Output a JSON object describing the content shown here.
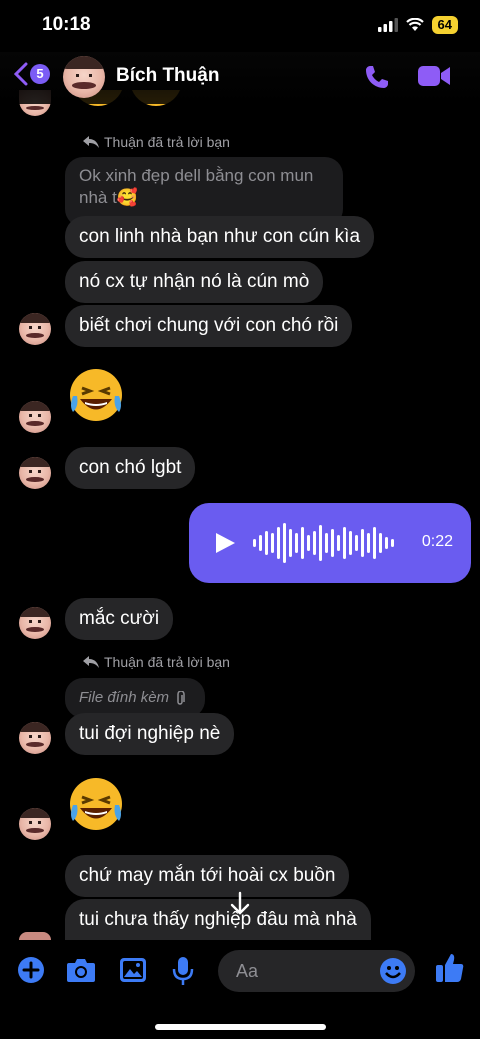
{
  "status_bar": {
    "time": "10:18",
    "battery": "64"
  },
  "header": {
    "back_count": "5",
    "contact_name": "Bích Thuận"
  },
  "messages": {
    "reply1_label": "Thuận đã trả lời bạn",
    "quoted1_line1": "Ok xinh đẹp dell bằng con mun",
    "quoted1_line2": "nhà t🥰",
    "m1": "con linh nhà bạn như con cún kìa",
    "m2": "nó cx tự nhận nó là cún mò",
    "m3": "biết chơi chung với con chó rồi",
    "m4": "con chó lgbt",
    "voice_duration": "0:22",
    "m5": "mắc cười",
    "reply2_label": "Thuận đã trả lời bạn",
    "quoted2": "File đính kèm",
    "m6": "tui đợi nghiệp nè",
    "m7": "chứ may mắn tới hoài cx buồn",
    "m8": "tui chưa thấy nghiệp đâu mà nhà"
  },
  "compose": {
    "placeholder": "Aa"
  },
  "colors": {
    "accent": "#8e5cf6",
    "voice_bubble": "#6a5cf0",
    "incoming_bubble": "#262628",
    "compose_icon": "#3d7bf5"
  }
}
